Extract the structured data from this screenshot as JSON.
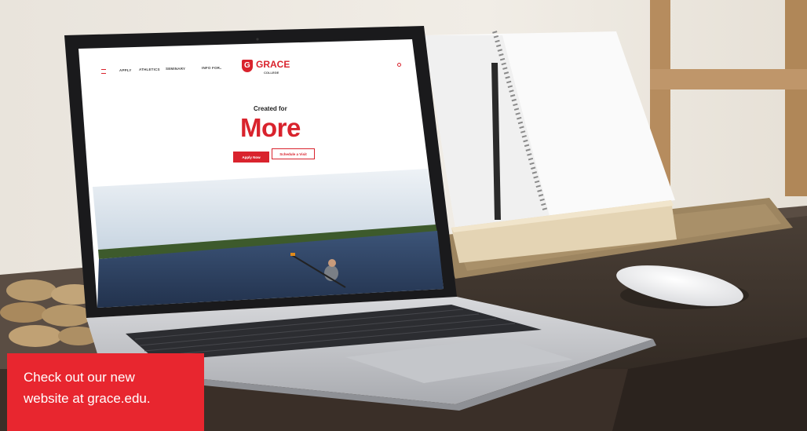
{
  "website": {
    "nav": {
      "apply": "APPLY",
      "athletics": "ATHLETICS",
      "seminary": "SEMINARY",
      "info_for": "INFO FOR"
    },
    "logo": {
      "letter": "G",
      "name": "GRACE",
      "sub": "COLLEGE"
    },
    "hero": {
      "subtitle": "Created for",
      "title": "More"
    },
    "buttons": {
      "apply_now": "Apply Now",
      "schedule_visit": "Schedule a Visit"
    }
  },
  "caption": {
    "line1": "Check out our new",
    "line2": "website at grace.edu."
  },
  "colors": {
    "brand_red": "#e8262f",
    "caption_text": "#ffffff"
  }
}
